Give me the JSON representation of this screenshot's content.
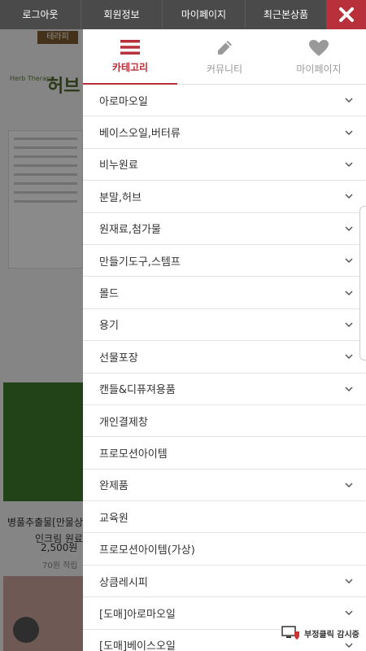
{
  "topbar": {
    "items": [
      "로그아웃",
      "회원정보",
      "마이페이지",
      "최근본상품"
    ]
  },
  "background": {
    "logo_text": "테라피",
    "brand_text": "허브",
    "brand_sub": "Herb Therapy",
    "product_name_1": "병풀추출물[만물상",
    "product_name_2": "인크림 원료",
    "product_price": "2,500원",
    "product_point": "70원 적립"
  },
  "tabs": [
    {
      "label": "카테고리",
      "icon": "menu-icon",
      "active": true
    },
    {
      "label": "커뮤니티",
      "icon": "pencil-icon",
      "active": false
    },
    {
      "label": "마이페이지",
      "icon": "heart-icon",
      "active": false
    }
  ],
  "menu": [
    {
      "label": "아로마오일",
      "has_chevron": true
    },
    {
      "label": "베이스오일,버터류",
      "has_chevron": true
    },
    {
      "label": "비누원료",
      "has_chevron": true
    },
    {
      "label": "분말,허브",
      "has_chevron": true
    },
    {
      "label": "원재료,첨가물",
      "has_chevron": true
    },
    {
      "label": "만들기도구,스템프",
      "has_chevron": true
    },
    {
      "label": "몰드",
      "has_chevron": true
    },
    {
      "label": "용기",
      "has_chevron": true
    },
    {
      "label": "선물포장",
      "has_chevron": true
    },
    {
      "label": "캔들&디퓨져용품",
      "has_chevron": true
    },
    {
      "label": "개인결제창",
      "has_chevron": false
    },
    {
      "label": "프로모션아이템",
      "has_chevron": false
    },
    {
      "label": "완제품",
      "has_chevron": true
    },
    {
      "label": "교육원",
      "has_chevron": false
    },
    {
      "label": "프로모션아이템(가상)",
      "has_chevron": false
    },
    {
      "label": "상큼레시피",
      "has_chevron": true
    },
    {
      "label": "[도매]아로마오일",
      "has_chevron": true
    },
    {
      "label": "[도매]베이스오일",
      "has_chevron": true
    }
  ],
  "fraud_badge": "부정클릭 감시중",
  "colors": {
    "accent": "#b7303a",
    "topbar": "#4a4a4a"
  }
}
